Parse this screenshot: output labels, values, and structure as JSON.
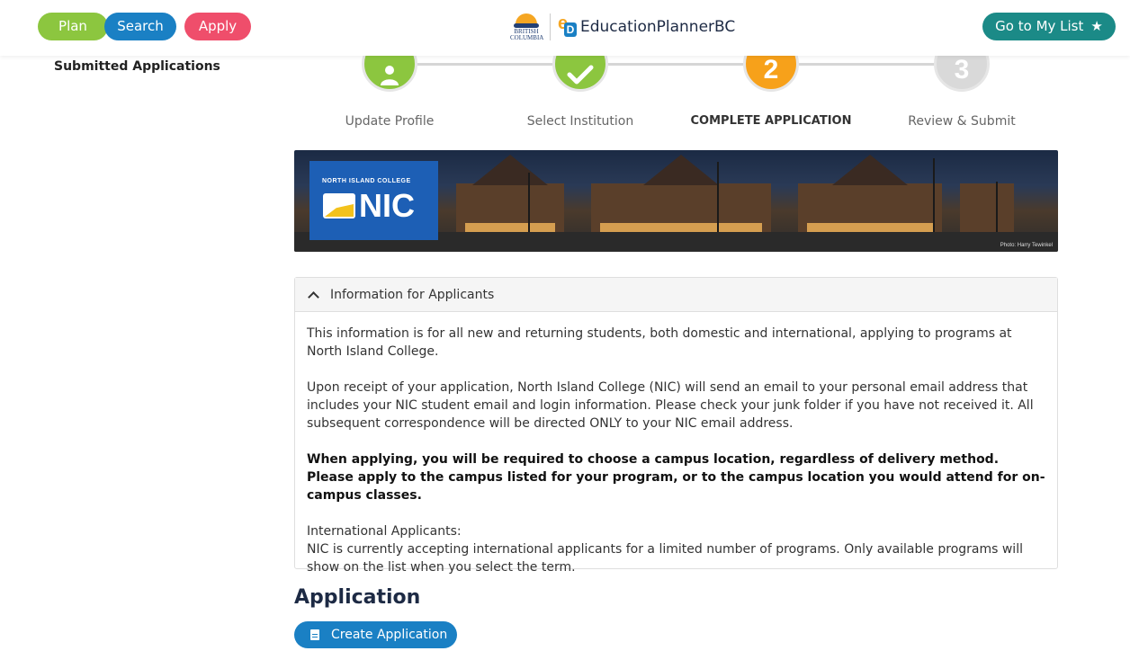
{
  "header": {
    "nav": {
      "plan": "Plan",
      "search": "Search",
      "apply": "Apply"
    },
    "brand_caption": "BRITISH COLUMBIA",
    "brand_name": "EducationPlannerBC",
    "my_list": "Go to My List",
    "colors": {
      "plan": "#8cc63f",
      "search": "#1a80c4",
      "apply": "#ef4e6b",
      "my_list": "#1b8a87"
    }
  },
  "sidebar": {
    "submitted_applications": "Submitted Applications"
  },
  "stepper": {
    "steps": [
      {
        "label": "Update Profile",
        "state": "done",
        "icon": "user-icon"
      },
      {
        "label": "Select Institution",
        "state": "done",
        "icon": "check-icon"
      },
      {
        "label": "COMPLETE APPLICATION",
        "state": "current",
        "number": "2"
      },
      {
        "label": "Review & Submit",
        "state": "upcoming",
        "number": "3"
      }
    ]
  },
  "banner": {
    "college_caption": "NORTH ISLAND COLLEGE",
    "logo_text": "NIC",
    "photo_credit": "Photo: Harry Tewinkel"
  },
  "info_panel": {
    "title": "Information for Applicants",
    "paragraphs": [
      "This information is for all new and returning students, both domestic and international, applying to programs at North Island College.",
      "Upon receipt of your application, North Island College (NIC) will send an email to your personal email address that includes your NIC student email and login information.  Please check your junk folder if you have not received it.  All subsequent correspondence will be directed ONLY to your NIC email address.",
      "When applying, you will be required to choose a campus location, regardless of delivery method.  Please apply to the campus listed for your program, or to the campus location you would attend for on-campus classes.",
      "International Applicants:",
      "NIC is currently accepting international applicants for a limited number of programs. Only available programs will show on the list when you select the term."
    ]
  },
  "application": {
    "heading": "Application",
    "create_button": "Create Application"
  }
}
